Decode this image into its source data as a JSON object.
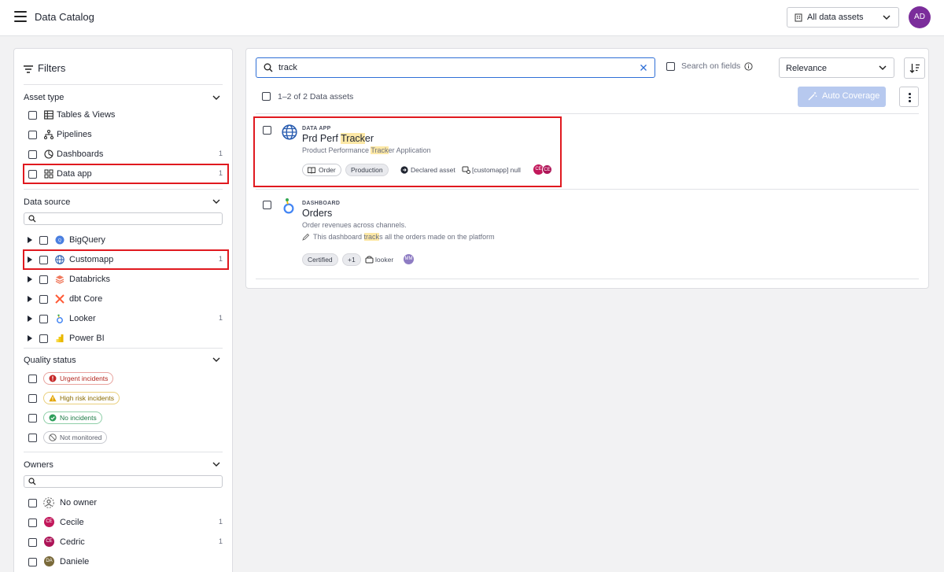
{
  "header": {
    "title": "Data Catalog",
    "asset_scope": "All data assets",
    "user_initials": "AD"
  },
  "filters": {
    "title": "Filters",
    "asset_type": {
      "title": "Asset type",
      "items": [
        {
          "label": "Tables & Views",
          "count": ""
        },
        {
          "label": "Pipelines",
          "count": ""
        },
        {
          "label": "Dashboards",
          "count": "1"
        },
        {
          "label": "Data app",
          "count": "1"
        }
      ]
    },
    "data_source": {
      "title": "Data source",
      "items": [
        {
          "label": "BigQuery",
          "count": ""
        },
        {
          "label": "Customapp",
          "count": "1"
        },
        {
          "label": "Databricks",
          "count": ""
        },
        {
          "label": "dbt Core",
          "count": ""
        },
        {
          "label": "Looker",
          "count": "1"
        },
        {
          "label": "Power BI",
          "count": ""
        }
      ]
    },
    "quality_status": {
      "title": "Quality status",
      "items": [
        {
          "label": "Urgent incidents"
        },
        {
          "label": "High risk incidents"
        },
        {
          "label": "No incidents"
        },
        {
          "label": "Not monitored"
        }
      ]
    },
    "owners": {
      "title": "Owners",
      "items": [
        {
          "label": "No owner",
          "initials": "",
          "count": ""
        },
        {
          "label": "Cecile",
          "initials": "CE",
          "count": "1"
        },
        {
          "label": "Cedric",
          "initials": "CE",
          "count": "1"
        },
        {
          "label": "Daniele",
          "initials": "DA",
          "count": ""
        }
      ]
    }
  },
  "search": {
    "value": "track",
    "search_on_fields_label": "Search on fields",
    "sort_label": "Relevance"
  },
  "results": {
    "count_label": "1–2 of 2 Data assets",
    "auto_coverage_label": "Auto Coverage",
    "items": [
      {
        "type": "DATA APP",
        "name_pre": "Prd Perf ",
        "name_hl": "Track",
        "name_post": "er",
        "desc_pre": "Product Performance ",
        "desc_hl": "Track",
        "desc_post": "er Application",
        "tags": [
          "Order",
          "Production"
        ],
        "declared": "Declared asset",
        "source": "[customapp] null",
        "owners": [
          "CE",
          "CE"
        ]
      },
      {
        "type": "DASHBOARD",
        "name": "Orders",
        "desc": "Order revenues across channels.",
        "note_pre": "This dashboard ",
        "note_hl": "track",
        "note_post": "s all the orders made on the platform",
        "tags": [
          "Certified",
          "+1"
        ],
        "source": "looker",
        "owners": [
          "MM"
        ]
      }
    ]
  },
  "colors": {
    "accent": "#2f6fd6",
    "highlight_box": "#e0191f",
    "search_highlight": "#fde8a6",
    "user_avatar": "#7b2d9b"
  }
}
